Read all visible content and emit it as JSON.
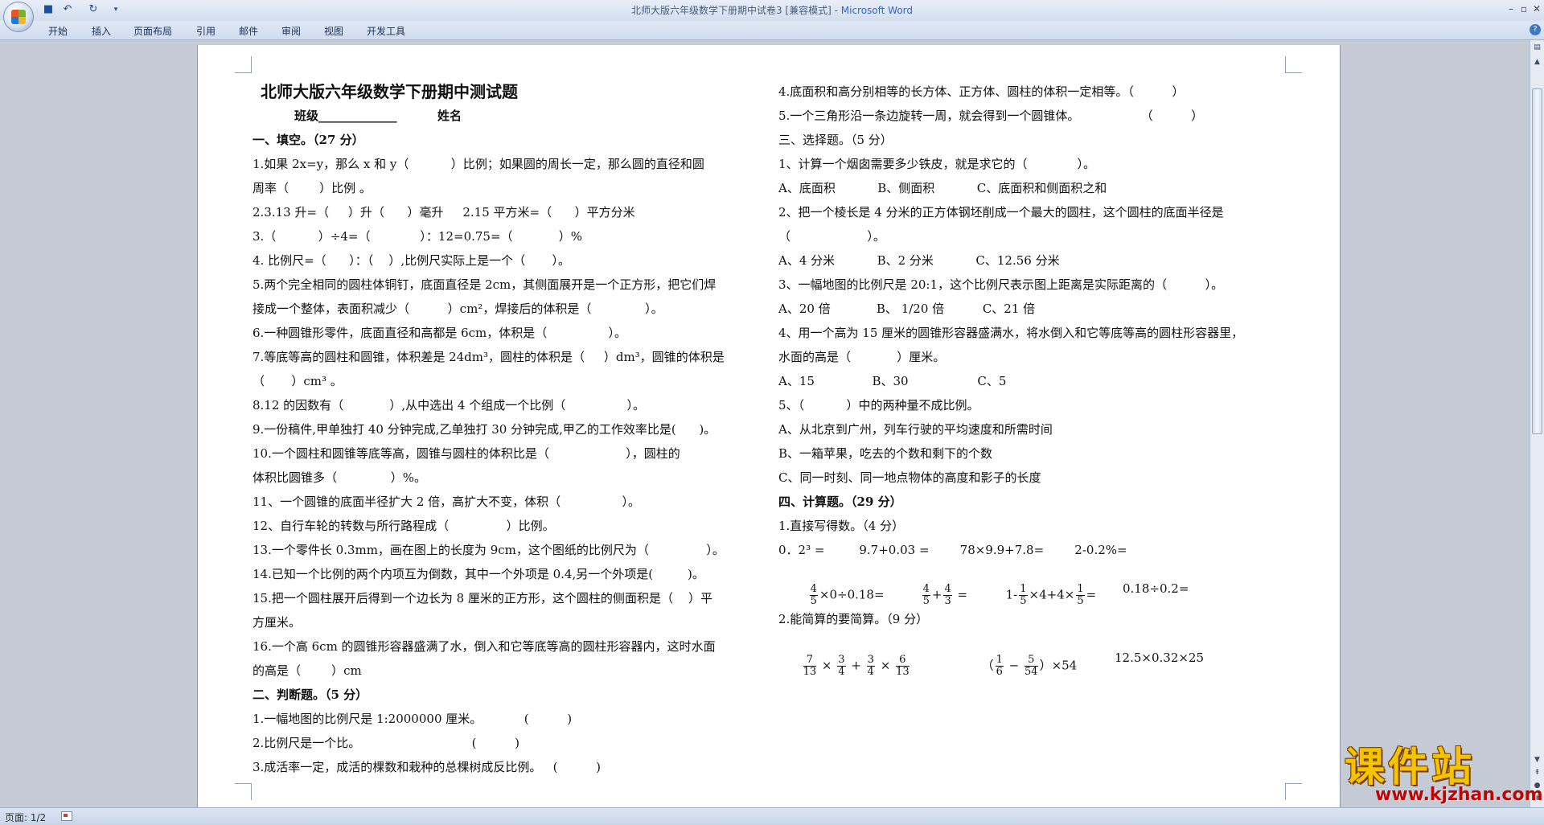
{
  "window": {
    "title": "北师大版六年级数学下册期中试卷3 [兼容模式] - ",
    "app_name": "Microsoft Word"
  },
  "quick_access": [
    "save-icon",
    "undo-icon",
    "redo-icon",
    "customize-icon"
  ],
  "ribbon": {
    "tabs": [
      "开始",
      "插入",
      "页面布局",
      "引用",
      "邮件",
      "审阅",
      "视图",
      "开发工具"
    ]
  },
  "help": "?",
  "document": {
    "title": "北师大版六年级数学下册期中测试题",
    "class_label": "班级_____________",
    "name_label": "姓名",
    "left": {
      "sec1": "一、填空。（27 分）",
      "l1": "1.如果 2x=y，那么 x 和 y（           ）比例；如果圆的周长一定，那么圆的直径和圆",
      "l2": "周率（        ）比例 。",
      "l3": "2.3.13 升=（     ）升（      ）毫升     2.15 平方米=（      ）平方分米",
      "l4": "3.（           ）÷4=（             ）：12=0.75=（            ）%",
      "l5": "4. 比例尺=（      ）：（    ）,比例尺实际上是一个（       ）。",
      "l6": "5.两个完全相同的圆柱体铜钉，底面直径是 2cm，其侧面展开是一个正方形，把它们焊",
      "l7": "接成一个整体，表面积减少（          ）cm²，焊接后的体积是（              ）。",
      "l8": "6.一种圆锥形零件，底面直径和高都是 6cm，体积是（                ）。",
      "l9": "7.等底等高的圆柱和圆锥，体积差是 24dm³，圆柱的体积是（     ）dm³，圆锥的体积是",
      "l10": "（       ）cm³ 。",
      "l11": "8.12 的因数有（            ）,从中选出 4 个组成一个比例（                ）。",
      "l12": "9.一份稿件,甲单独打 40 分钟完成,乙单独打 30 分钟完成,甲乙的工作效率比是(      )。",
      "l13": "10.一个圆柱和圆锥等底等高，圆锥与圆柱的体积比是（                    ），圆柱的",
      "l14": "体积比圆锥多（              ）%。",
      "l15": "11、一个圆锥的底面半径扩大 2 倍，高扩大不变，体积（                ）。",
      "l16": "12、自行车轮的转数与所行路程成（               ）比例。",
      "l17": "13.一个零件长 0.3mm，画在图上的长度为 9cm，这个图纸的比例尺为（               ）。",
      "l18": "14.已知一个比例的两个内项互为倒数，其中一个外项是 0.4,另一个外项是(         )。",
      "l19": "15.把一个圆柱展开后得到一个边长为 8 厘米的正方形，这个圆柱的侧面积是（    ）平",
      "l20": "方厘米。",
      "l21": "16.一个高 6cm 的圆锥形容器盛满了水，倒入和它等底等高的圆柱形容器内，这时水面",
      "l22": "的高是（        ）cm",
      "sec2": "二、判断题。（5 分）",
      "l23": "1.一幅地图的比例尺是 1:2000000 厘米。           (          )",
      "l24": "2.比例尺是一个比。                             (          )",
      "l25": "3.成活率一定，成活的棵数和栽种的总棵树成反比例。   (          )"
    },
    "right": {
      "r1": "4.底面积和高分别相等的长方体、正方体、圆柱的体积一定相等。（          ）",
      "r2": "5.一个三角形沿一条边旋转一周，就会得到一个圆锥体。                （          ）",
      "sec3": "三、选择题。（5 分）",
      "r3": "1、计算一个烟囱需要多少铁皮，就是求它的（             ）。",
      "r4": "A、底面积           B、侧面积           C、底面积和侧面积之和",
      "r5": "2、把一个棱长是 4 分米的正方体钢坯削成一个最大的圆柱，这个圆柱的底面半径是",
      "r6": "（                    ）。",
      "r7": "A、4 分米           B、2 分米           C、12.56 分米",
      "r8": "3、一幅地图的比例尺是 20:1，这个比例尺表示图上距离是实际距离的（          ）。",
      "r9": "A、20 倍            B、 1/20 倍          C、21 倍",
      "r10": "4、用一个高为 15 厘米的圆锥形容器盛满水，将水倒入和它等底等高的圆柱形容器里，",
      "r11": "水面的高是（            ）厘米。",
      "r12": "A、15               B、30                  C、5",
      "r13": "5、（           ）中的两种量不成比例。",
      "r14": "A、从北京到广州，列车行驶的平均速度和所需时间",
      "r15": "B、一箱苹果，吃去的个数和剩下的个数",
      "r16": "C、同一时刻、同一地点物体的高度和影子的长度",
      "sec4": "四、计算题。（29 分）",
      "r17": "1.直接写得数。（4 分）",
      "r18": "0．2³ =         9.7+0.03 =        78×9.9+7.8=        2-0.2%=",
      "calc1": {
        "a": [
          "4",
          "5",
          "×0÷0.18="
        ],
        "b": [
          "4",
          "5",
          "+",
          "4",
          "3",
          " ="
        ],
        "c": [
          "1-",
          "1",
          "5",
          "×4+4×",
          "1",
          "5",
          "="
        ],
        "d": "0.18÷0.2="
      },
      "r19": "2.能简算的要简算。（9 分）",
      "calc2": {
        "a": [
          "7",
          "13",
          " × ",
          "3",
          "4",
          " + ",
          "3",
          "4",
          " × ",
          "6",
          "13"
        ],
        "b": [
          "（",
          "1",
          "6",
          " − ",
          "5",
          "54",
          "）×54"
        ],
        "c": "12.5×0.32×25"
      }
    }
  },
  "status": {
    "page": "页面: 1/2"
  },
  "watermark": {
    "text": "课件站",
    "url": "www.kjzhan.com"
  }
}
